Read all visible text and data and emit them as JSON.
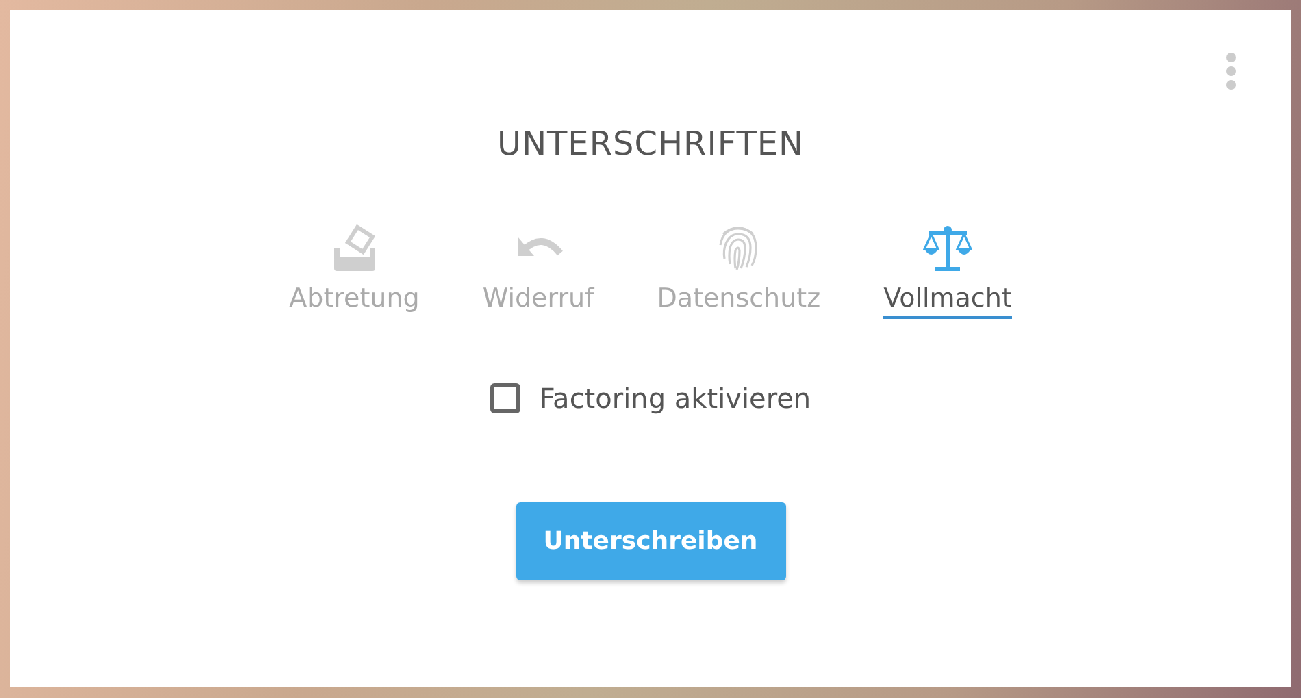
{
  "title": "UNTERSCHRIFTEN",
  "tabs": [
    {
      "label": "Abtretung",
      "kind": "eraser",
      "selected": false
    },
    {
      "label": "Widerruf",
      "kind": "undo",
      "selected": false
    },
    {
      "label": "Datenschutz",
      "kind": "fingerprint",
      "selected": false
    },
    {
      "label": "Vollmacht",
      "kind": "scale",
      "selected": true
    }
  ],
  "checkbox": {
    "label": "Factoring aktivieren",
    "checked": false
  },
  "button": {
    "label": "Unterschreiben"
  }
}
